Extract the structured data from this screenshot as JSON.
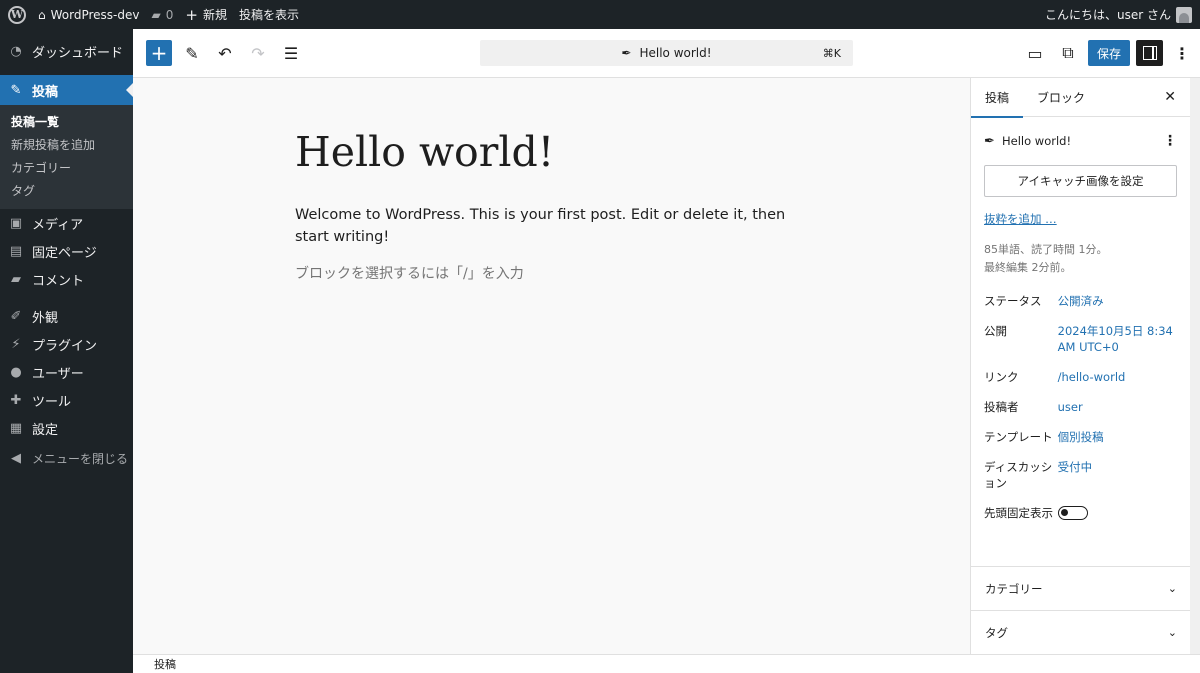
{
  "admin_bar": {
    "site_name": "WordPress-dev",
    "comments_count": "0",
    "new_label": "新規",
    "view_post_label": "投稿を表示",
    "greeting": "こんにちは、user さん"
  },
  "sidebar": {
    "dashboard": "ダッシュボード",
    "posts": "投稿",
    "submenu": [
      "投稿一覧",
      "新規投稿を追加",
      "カテゴリー",
      "タグ"
    ],
    "media": "メディア",
    "pages": "固定ページ",
    "comments": "コメント",
    "appearance": "外観",
    "plugins": "プラグイン",
    "users": "ユーザー",
    "tools": "ツール",
    "settings": "設定",
    "collapse": "メニューを閉じる"
  },
  "header": {
    "command_title": "Hello world!",
    "command_shortcut": "⌘K",
    "save_label": "保存"
  },
  "post": {
    "title": "Hello world!",
    "paragraph": "Welcome to WordPress. This is your first post. Edit or delete it, then start writing!",
    "placeholder": "ブロックを選択するには「/」を入力"
  },
  "inspector": {
    "tab_post": "投稿",
    "tab_block": "ブロック",
    "card_title": "Hello world!",
    "featured_image_label": "アイキャッチ画像を設定",
    "excerpt_link": "抜粋を追加 …",
    "word_count": "85単語、読了時間 1分。",
    "last_edited": "最終編集 2分前。",
    "status_label": "ステータス",
    "status_value": "公開済み",
    "publish_label": "公開",
    "publish_value": "2024年10月5日 8:34 AM UTC+0",
    "link_label": "リンク",
    "link_value": "/hello-world",
    "author_label": "投稿者",
    "author_value": "user",
    "template_label": "テンプレート",
    "template_value": "個別投稿",
    "discussion_label": "ディスカッション",
    "discussion_value": "受付中",
    "sticky_label": "先頭固定表示",
    "categories_panel": "カテゴリー",
    "tags_panel": "タグ"
  },
  "footer": {
    "breadcrumb": "投稿"
  },
  "icons": [
    "wordpress-icon",
    "home-icon",
    "comment-icon",
    "plus-icon",
    "dashboard-icon",
    "pin-icon",
    "media-icon",
    "page-icon",
    "appearance-icon",
    "plugin-icon",
    "user-icon",
    "tool-icon",
    "settings-icon",
    "collapse-icon",
    "pencil-icon",
    "undo-icon",
    "redo-icon",
    "list-view-icon",
    "feather-icon",
    "desktop-preview-icon",
    "external-link-icon",
    "sidebar-toggle-icon",
    "more-vertical-icon",
    "close-icon",
    "chevron-down-icon"
  ],
  "colors": {
    "admin_dark": "#1d2327",
    "accent": "#2271b1"
  }
}
